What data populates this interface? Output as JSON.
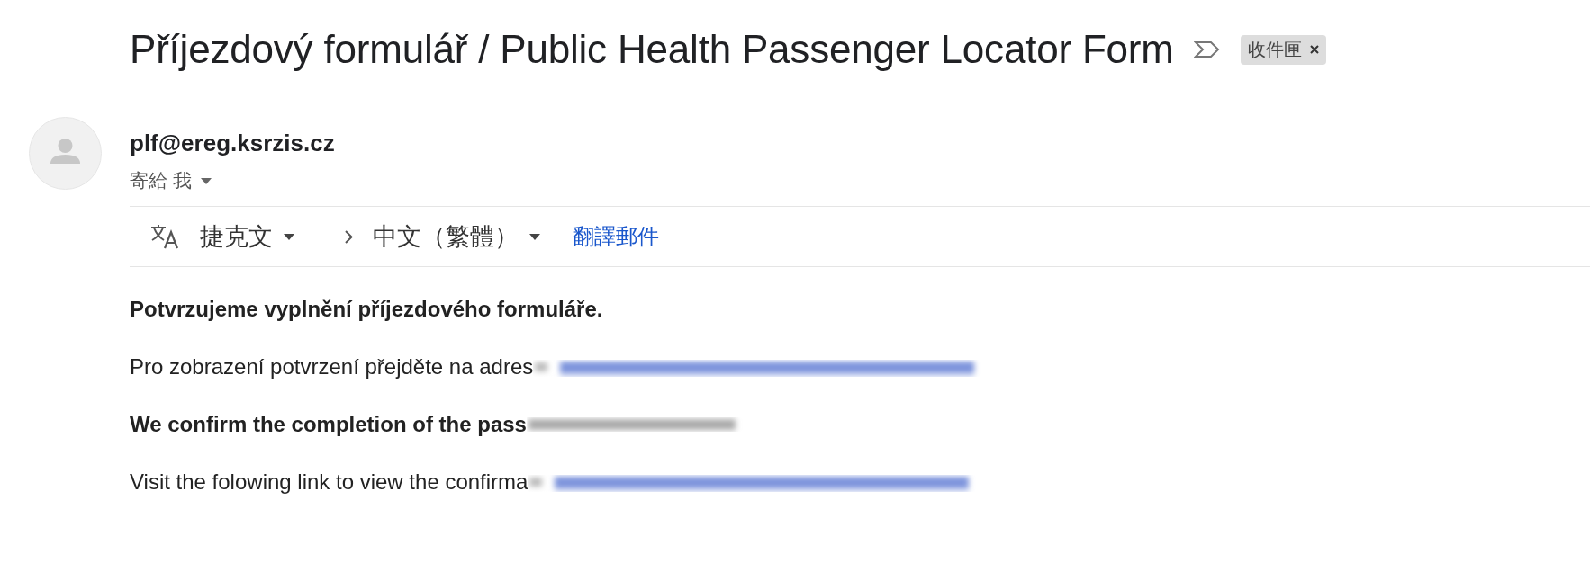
{
  "subject": {
    "title": "Příjezdový formulář / Public Health Passenger Locator Form",
    "label": "收件匣"
  },
  "sender": {
    "address": "plf@ereg.ksrzis.cz",
    "recipient": "寄給 我"
  },
  "translate_bar": {
    "source_language": "捷克文",
    "target_language": "中文（繁體）",
    "action": "翻譯郵件"
  },
  "body": [
    {
      "kind": "heading",
      "text": "Potvrzujeme vyplnění příjezdového formuláře."
    },
    {
      "kind": "link_line",
      "text": "Pro zobrazení potvrzení přejděte na adres"
    },
    {
      "kind": "heading_blurred",
      "text": "We confirm the completion of the pass"
    },
    {
      "kind": "link_line",
      "text": "Visit the folowing link to view the confirma"
    }
  ]
}
